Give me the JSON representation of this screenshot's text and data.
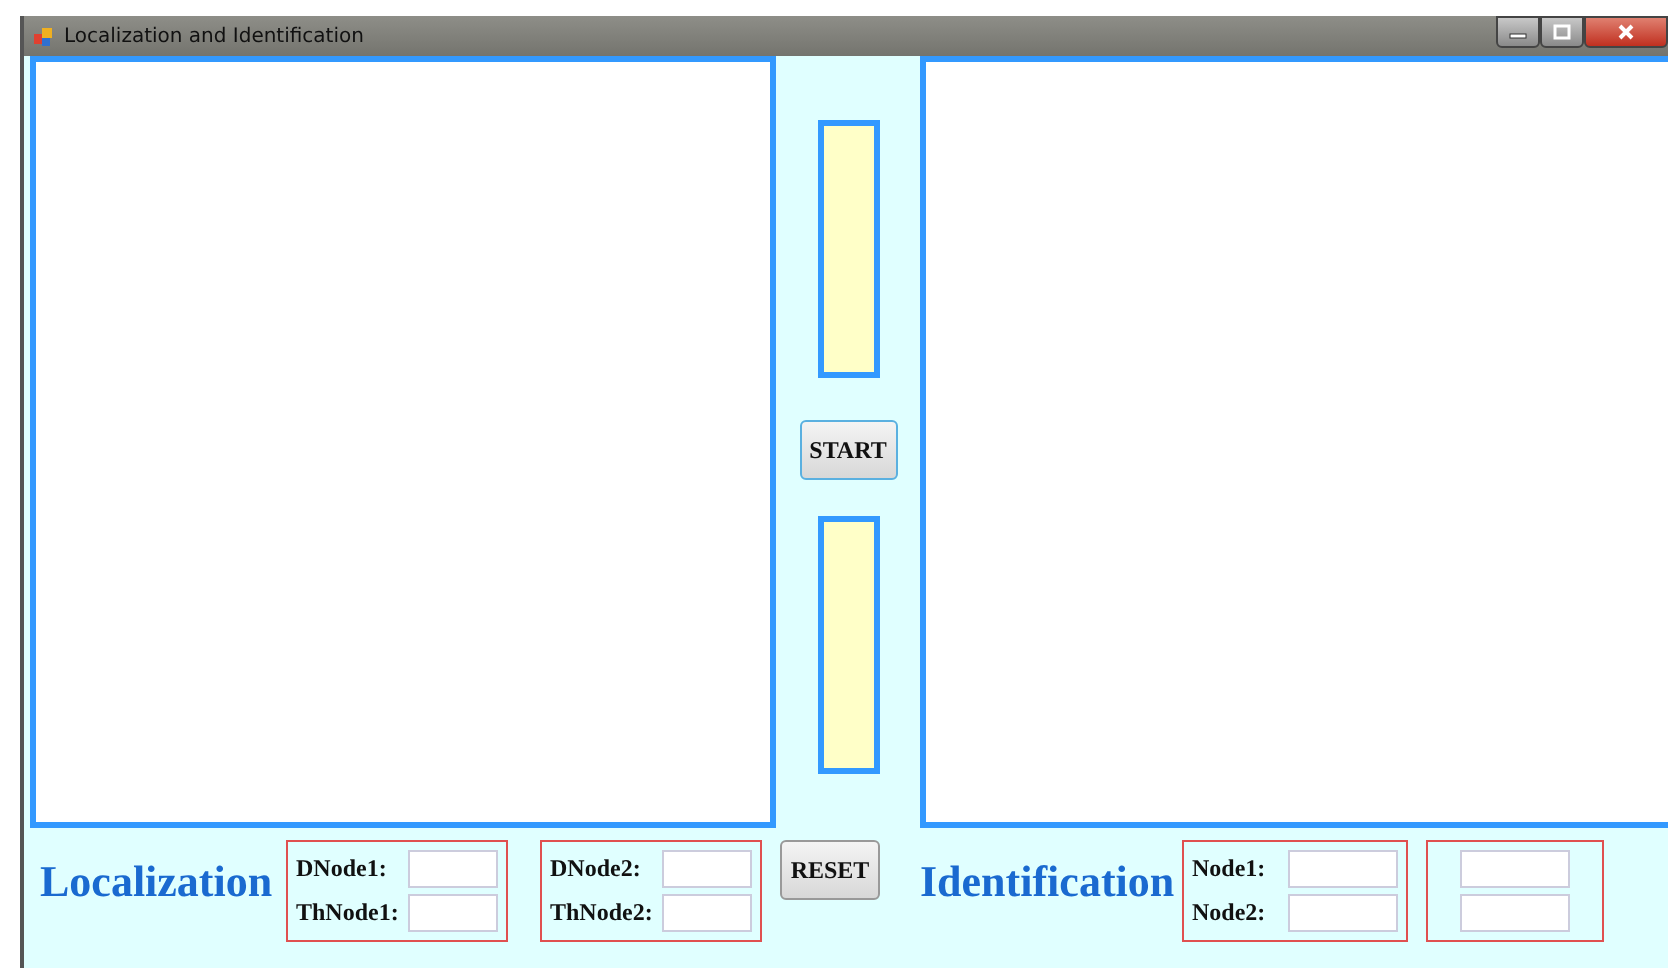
{
  "window": {
    "title": "Localization and Identification"
  },
  "start_button": "START",
  "reset_button": "RESET",
  "localization": {
    "heading": "Localization",
    "groups": [
      {
        "fields": [
          {
            "kind": "labeled",
            "label": "DNode1:"
          },
          {
            "kind": "labeled",
            "label": "ThNode1:"
          }
        ]
      },
      {
        "fields": [
          {
            "kind": "labeled",
            "label": "DNode2:"
          },
          {
            "kind": "labeled",
            "label": "ThNode2:"
          }
        ]
      }
    ]
  },
  "identification": {
    "heading": "Identification",
    "groups": [
      {
        "fields": [
          {
            "kind": "labeled",
            "label": "Node1:"
          },
          {
            "kind": "labeled",
            "label": "Node2:"
          }
        ]
      },
      {
        "fields": [
          {
            "kind": "blank"
          },
          {
            "kind": "blank"
          }
        ]
      }
    ]
  }
}
